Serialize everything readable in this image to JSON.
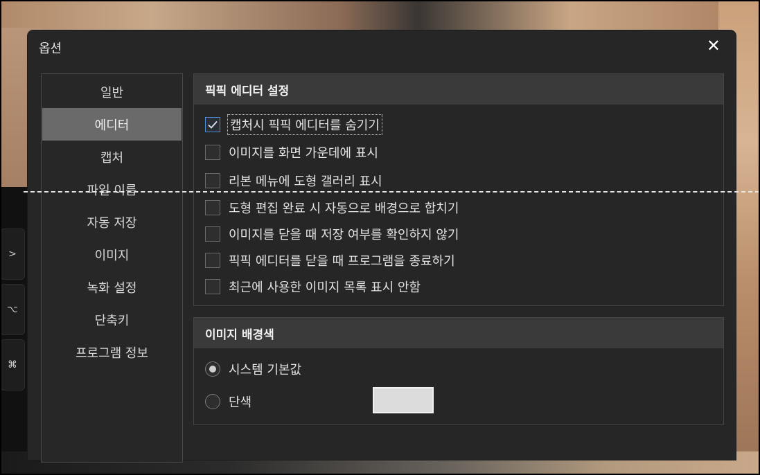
{
  "dialog": {
    "title": "옵션",
    "close_glyph": "✕"
  },
  "sidebar": {
    "items": [
      {
        "label": "일반",
        "active": false
      },
      {
        "label": "에디터",
        "active": true
      },
      {
        "label": "캡처",
        "active": false
      },
      {
        "label": "파일 이름",
        "active": false
      },
      {
        "label": "자동 저장",
        "active": false
      },
      {
        "label": "이미지",
        "active": false
      },
      {
        "label": "녹화 설정",
        "active": false
      },
      {
        "label": "단축키",
        "active": false
      },
      {
        "label": "프로그램 정보",
        "active": false
      }
    ]
  },
  "editor_section": {
    "title": "픽픽 에디터 설정",
    "options": [
      {
        "label": "캡처시 픽픽 에디터를 숨기기",
        "checked": true
      },
      {
        "label": "이미지를 화면 가운데에 표시",
        "checked": false
      },
      {
        "label": "리본 메뉴에 도형 갤러리 표시",
        "checked": false
      },
      {
        "label": "도형 편집 완료 시 자동으로 배경으로 합치기",
        "checked": false
      },
      {
        "label": "이미지를 닫을 때 저장 여부를 확인하지 않기",
        "checked": false
      },
      {
        "label": "픽픽 에디터를 닫을 때 프로그램을 종료하기",
        "checked": false
      },
      {
        "label": "최근에 사용한 이미지 목록 표시 안함",
        "checked": false
      }
    ]
  },
  "background_section": {
    "title": "이미지 배경색",
    "options": [
      {
        "label": "시스템 기본값",
        "selected": true
      },
      {
        "label": "단색",
        "selected": false
      }
    ],
    "solid_color": "#dcdcdc"
  },
  "background": {
    "keys": ">",
    "keys2": "⌥",
    "keys3": "⌘"
  },
  "colors": {
    "dialog_bg": "#262626",
    "active_nav": "#6a6a6a",
    "check_accent": "#4a8fd8"
  }
}
